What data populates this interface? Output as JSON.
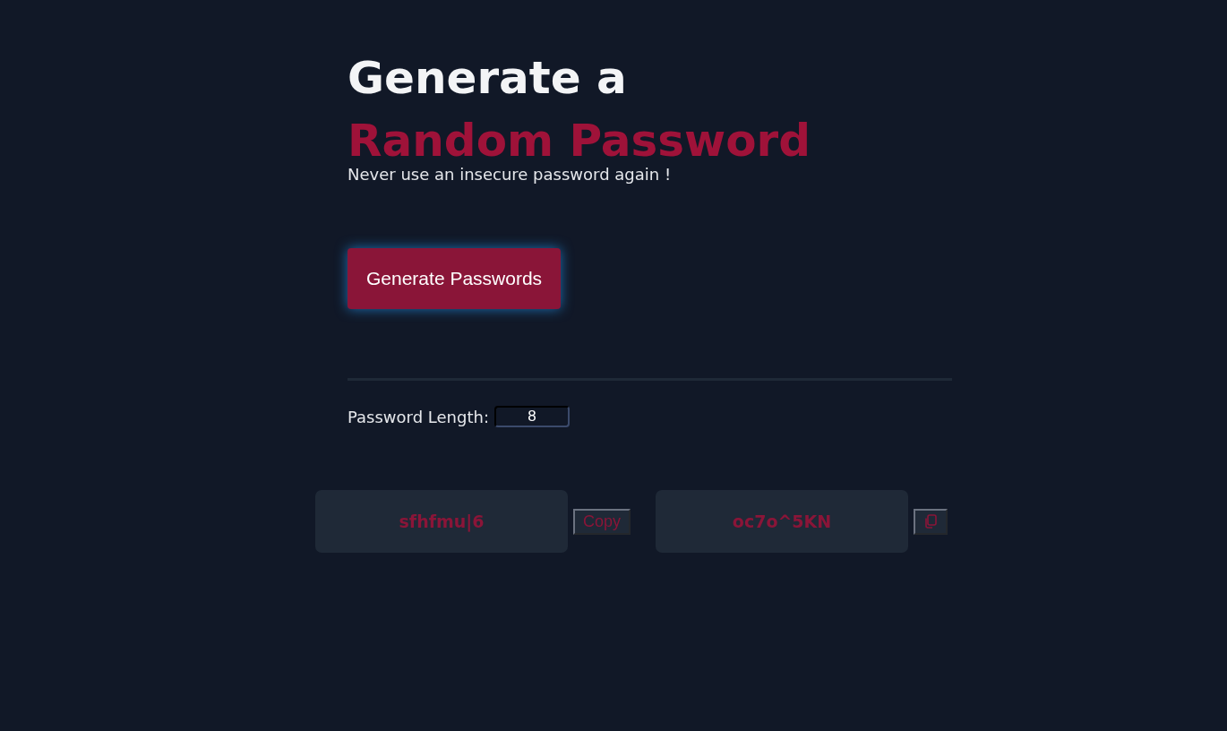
{
  "heading": {
    "line_1": "Generate a",
    "line_2": "Random Password"
  },
  "subtitle": "Never use an insecure password again !",
  "generate_button": {
    "label": "Generate Passwords"
  },
  "length_field": {
    "label": "Password Length:",
    "value": "8"
  },
  "passwords": [
    {
      "value": "sfhfmu|6",
      "copy": {
        "kind": "text",
        "label": "Copy"
      }
    },
    {
      "value": "oc7o^5KN",
      "copy": {
        "kind": "icon"
      }
    }
  ]
}
